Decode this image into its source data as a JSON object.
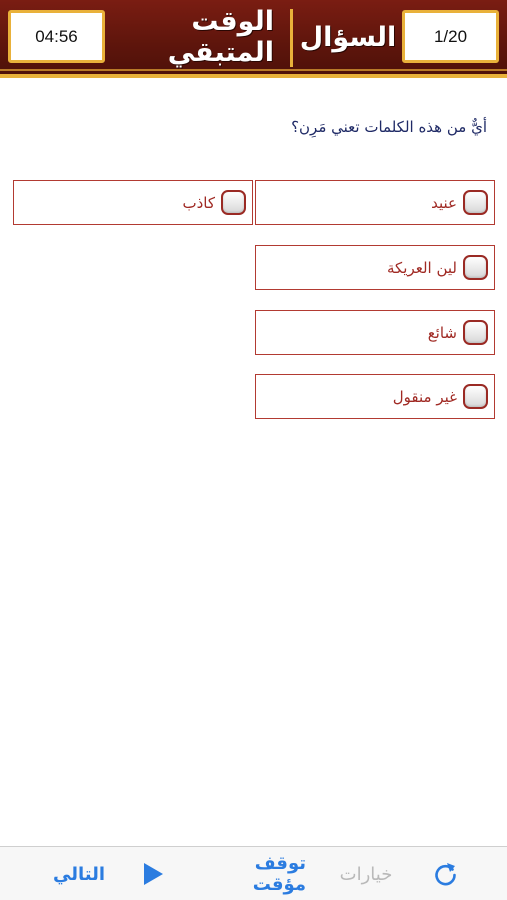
{
  "header": {
    "timer": "04:56",
    "time_remaining_label": "الوقت المتبقي",
    "question_label": "السؤال",
    "question_counter": "1/20"
  },
  "question": {
    "text": "أيٌّ من هذه الكلمات تعني مَرِن؟"
  },
  "options": [
    {
      "label": "عنيد"
    },
    {
      "label": "كاذب"
    },
    {
      "label": "لين العريكة"
    },
    {
      "label": "شائع"
    },
    {
      "label": "غير منقول"
    }
  ],
  "toolbar": {
    "next_label": "التالي",
    "pause_label": "توقف مؤقت",
    "options_label": "خيارات",
    "icons": {
      "play": "play-icon",
      "refresh": "refresh-icon"
    }
  },
  "colors": {
    "header_bg": "#6a190f",
    "header_gold": "#e9b13a",
    "option_border": "#b23a32",
    "option_text": "#a02a24",
    "question_text": "#1f2a66",
    "toolbar_accent": "#2b7ce0",
    "toolbar_disabled": "#b9b9b9"
  }
}
